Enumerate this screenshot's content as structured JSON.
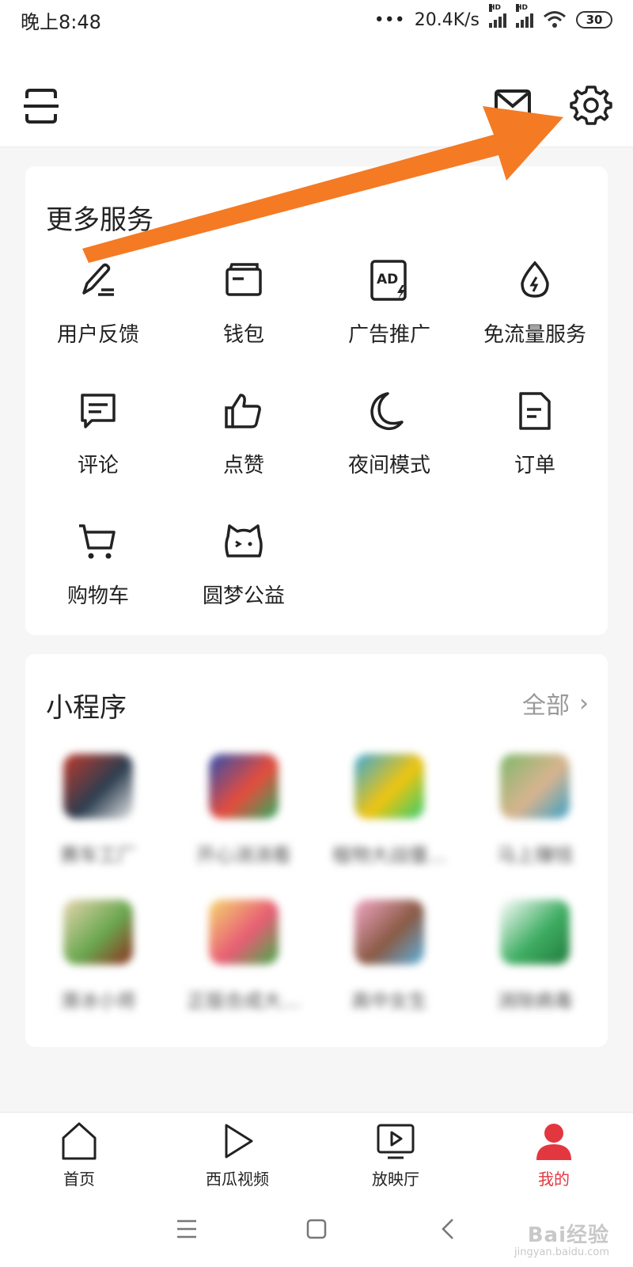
{
  "status_bar": {
    "time": "晚上8:48",
    "network_speed": "20.4K/s",
    "battery": "30",
    "hd_label": "HD"
  },
  "header": {
    "scan_icon": "scan-icon",
    "mail_icon": "mail-icon",
    "settings_icon": "gear-icon"
  },
  "services": {
    "title": "更多服务",
    "items": [
      {
        "label": "用户反馈",
        "icon": "edit-pen-icon"
      },
      {
        "label": "钱包",
        "icon": "wallet-icon"
      },
      {
        "label": "广告推广",
        "icon": "ad-icon"
      },
      {
        "label": "免流量服务",
        "icon": "data-drop-icon"
      },
      {
        "label": "评论",
        "icon": "comment-icon"
      },
      {
        "label": "点赞",
        "icon": "thumbs-up-icon"
      },
      {
        "label": "夜间模式",
        "icon": "moon-icon"
      },
      {
        "label": "订单",
        "icon": "order-doc-icon"
      },
      {
        "label": "购物车",
        "icon": "cart-icon"
      },
      {
        "label": "圆梦公益",
        "icon": "cat-face-icon"
      }
    ]
  },
  "mini_programs": {
    "title": "小程序",
    "all_label": "全部",
    "items": [
      {
        "label": "赛车工厂",
        "colors": [
          "#c0392b",
          "#2c3e50",
          "#e8e8e8"
        ]
      },
      {
        "label": "开心消消看",
        "colors": [
          "#2d4fb0",
          "#e74c3c",
          "#27ae60"
        ]
      },
      {
        "label": "植物大战僵…",
        "colors": [
          "#3aa8d8",
          "#f1c40f",
          "#2ecc71"
        ]
      },
      {
        "label": "马上赚钱",
        "colors": [
          "#7fb76a",
          "#d9b48f",
          "#35a0c8"
        ]
      },
      {
        "label": "滑冰小将",
        "colors": [
          "#e7d5b0",
          "#6aa84f",
          "#8e2d1f"
        ]
      },
      {
        "label": "正版合成大…",
        "colors": [
          "#f5d76e",
          "#e85d75",
          "#3fae49"
        ]
      },
      {
        "label": "高中女生",
        "colors": [
          "#f3a8c8",
          "#8a5a44",
          "#5db3e3"
        ]
      },
      {
        "label": "消除病毒",
        "colors": [
          "#ffffff",
          "#3fae63",
          "#1f7a3b"
        ]
      }
    ]
  },
  "bottom_nav": [
    {
      "label": "首页",
      "icon": "home-icon",
      "active": false
    },
    {
      "label": "西瓜视频",
      "icon": "play-icon",
      "active": false
    },
    {
      "label": "放映厅",
      "icon": "tv-play-icon",
      "active": false
    },
    {
      "label": "我的",
      "icon": "user-icon",
      "active": true
    }
  ],
  "system_nav": {
    "menu_icon": "menu-icon",
    "home_icon": "square-home-icon",
    "back_icon": "back-icon"
  },
  "watermark": {
    "text": "Bai经验",
    "sub": "jingyan.baidu.com"
  },
  "colors": {
    "accent": "#e3373f",
    "annotation_arrow": "#f47a24"
  }
}
